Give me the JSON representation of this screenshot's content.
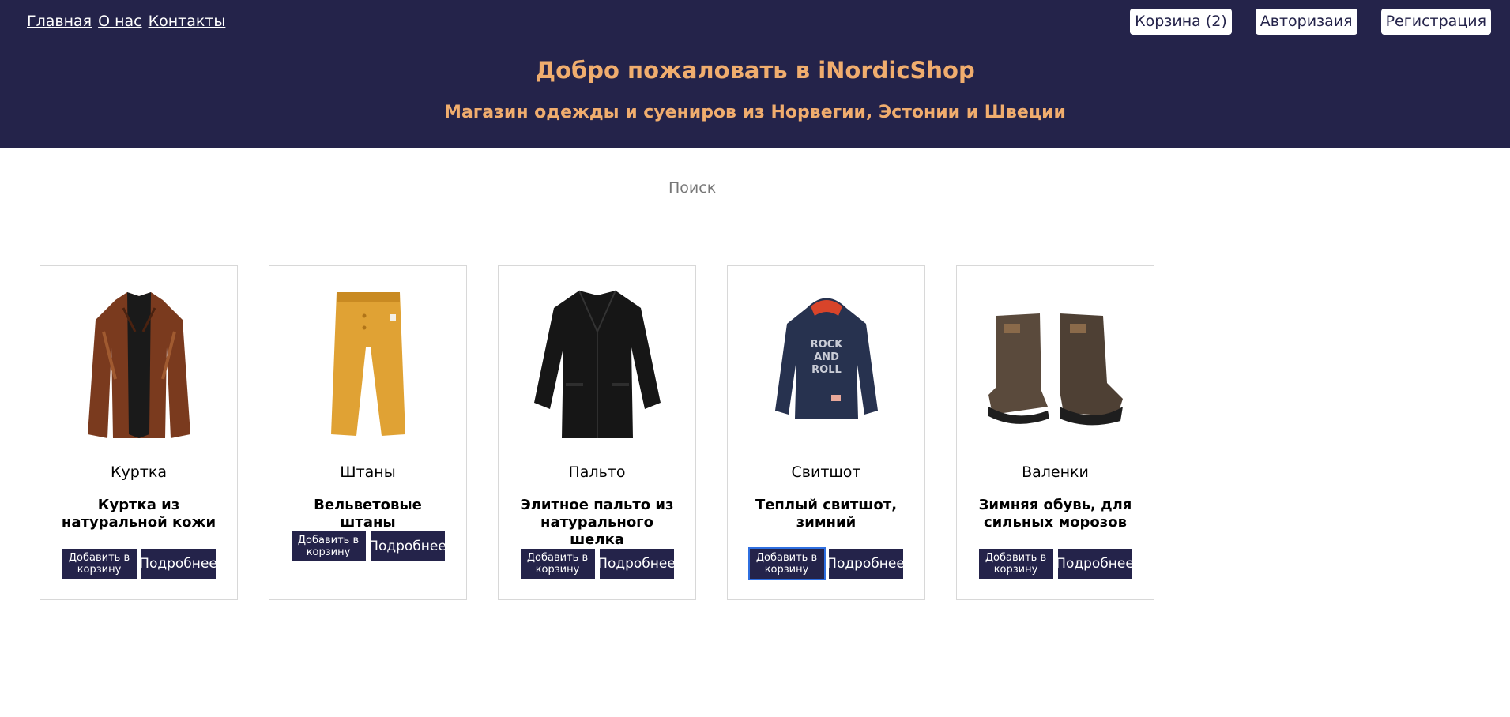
{
  "nav": {
    "home": "Главная",
    "about": "О нас",
    "contacts": "Контакты"
  },
  "auth": {
    "cart": "Корзина (2)",
    "login": "Авторизаия",
    "register": "Регистрация"
  },
  "hero": {
    "title": "Добро пожаловать в iNordicShop",
    "subtitle": "Магазин одежды и суениров из Норвегии, Эстонии и Швеции"
  },
  "search": {
    "placeholder": "Поиск"
  },
  "colors": {
    "primary": "#24234a",
    "accent": "#f0ad6e",
    "focus": "#2f6fe0"
  },
  "products": [
    {
      "category": "Куртка",
      "description": "Куртка из натуральной кожи",
      "add": "Добавить в корзину",
      "more": "Подробнее",
      "image": "leather-jacket-image"
    },
    {
      "category": "Штаны",
      "description": "Вельветовые штаны",
      "add": "Добавить в корзину",
      "more": "Подробнее",
      "image": "yellow-pants-image"
    },
    {
      "category": "Пальто",
      "description": "Элитное пальто из натурального шелка",
      "add": "Добавить в корзину",
      "more": "Подробнее",
      "image": "black-coat-image"
    },
    {
      "category": "Свитшот",
      "description": "Теплый свитшот, зимний",
      "add": "Добавить в корзину",
      "more": "Подробнее",
      "image": "hoodie-image",
      "hoodie_print": [
        "ROCK",
        "AND",
        "ROLL"
      ]
    },
    {
      "category": "Валенки",
      "description": "Зимняя обувь, для сильных морозов",
      "add": "Добавить в корзину",
      "more": "Подробнее",
      "image": "felt-boots-image"
    }
  ]
}
